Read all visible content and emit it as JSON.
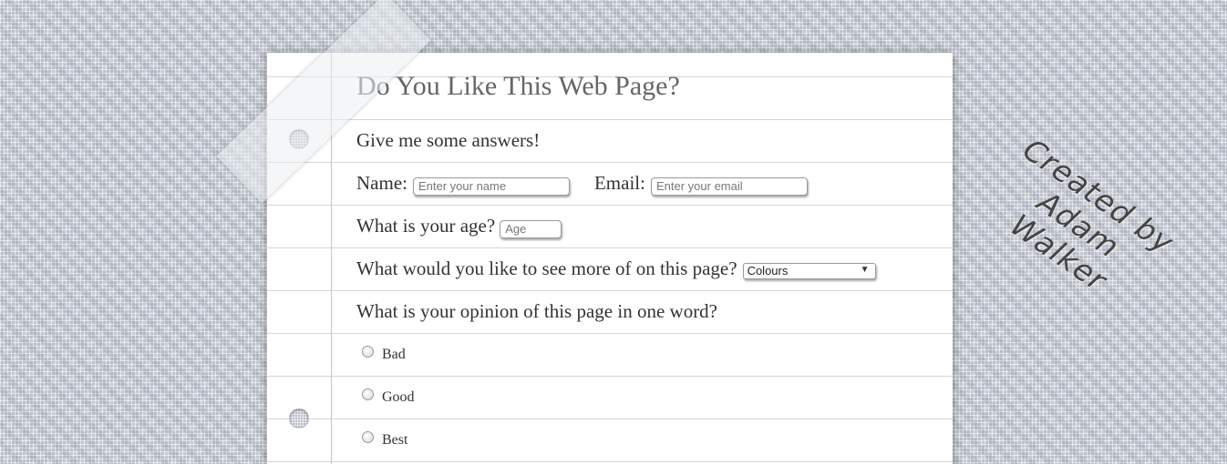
{
  "survey": {
    "title": "Do You Like This Web Page?",
    "intro": "Give me some answers!",
    "name_label": "Name:",
    "name_placeholder": "Enter your name",
    "email_label": "Email:",
    "email_placeholder": "Enter your email",
    "age_label": "What is your age?",
    "age_placeholder": "Age",
    "more_label": "What would you like to see more of on this page?",
    "more_selected": "Colours",
    "opinion_label": "What is your opinion of this page in one word?",
    "options": [
      "Bad",
      "Good",
      "Best"
    ]
  },
  "credit": {
    "line1": "Created by",
    "line2": "Adam Walker"
  },
  "colors": {
    "background": "#b9bec9",
    "paper": "#ffffff",
    "margin_line": "#e8b9a8",
    "rule_line": "#d6d6d6"
  },
  "icons": {
    "dropdown": "triangle-down-icon",
    "radio": "radio-icon",
    "binder_hole": "circle-icon"
  }
}
